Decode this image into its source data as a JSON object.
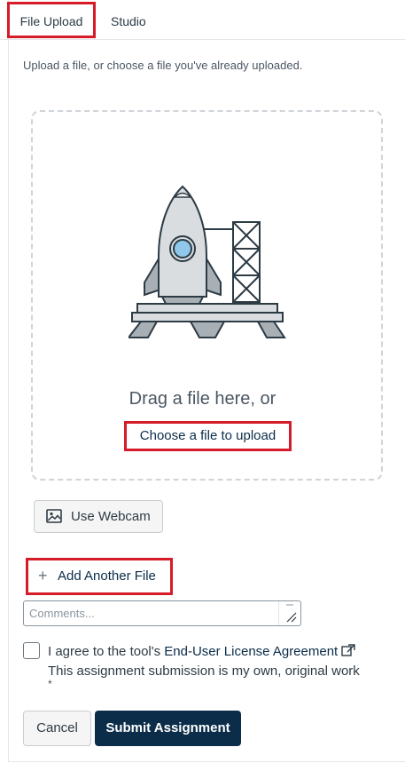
{
  "tabs": [
    {
      "label": "File Upload",
      "selected": true
    },
    {
      "label": "Studio",
      "selected": false
    }
  ],
  "intro_text": "Upload a file, or choose a file you've already uploaded.",
  "dropzone": {
    "illustration": "rocket-launchpad-illustration",
    "drag_text": "Drag a file here, or",
    "choose_link": "Choose a file to upload"
  },
  "webcam_button": {
    "label": "Use Webcam",
    "icon": "image-icon"
  },
  "add_file": {
    "label": "Add Another File",
    "icon": "plus-icon"
  },
  "comments": {
    "placeholder": "Comments..."
  },
  "agreement": {
    "prefix": "I agree to the tool's ",
    "link": "End-User License Agreement",
    "line2": "This assignment submission is my own, original work",
    "required_mark": "*",
    "checked": false
  },
  "actions": {
    "cancel": "Cancel",
    "submit": "Submit Assignment"
  },
  "colors": {
    "accent": "#0b2d49",
    "highlight": "#d51c28",
    "border": "#c7cdd1"
  }
}
